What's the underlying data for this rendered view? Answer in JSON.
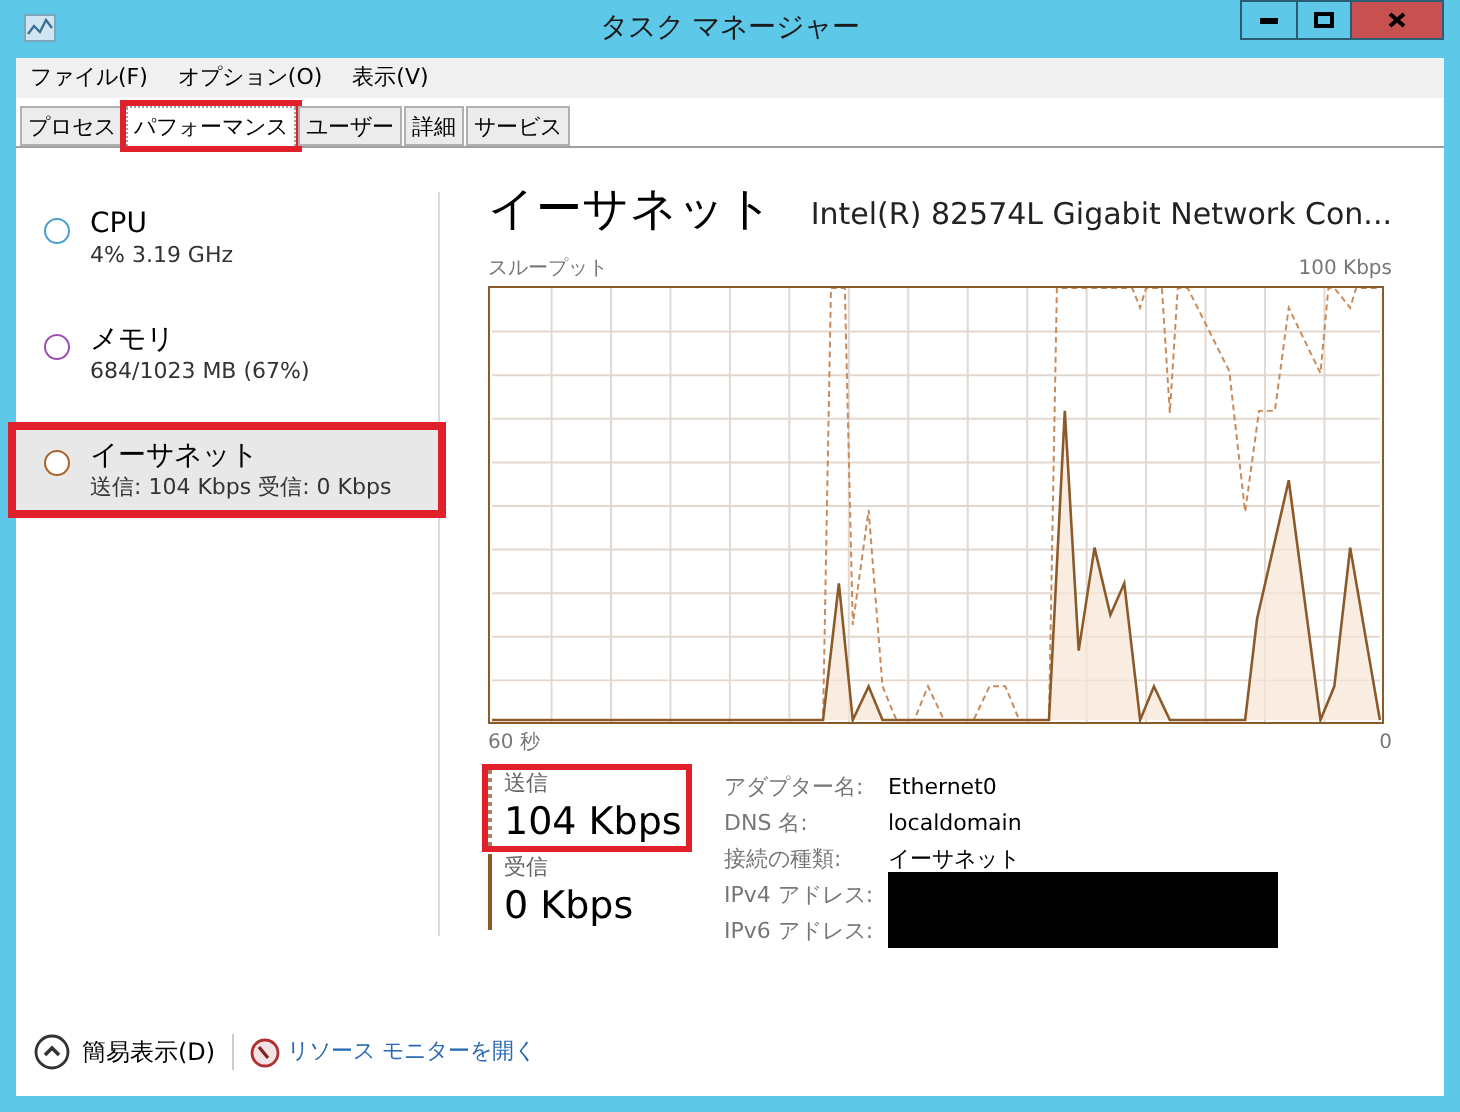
{
  "window": {
    "title": "タスク マネージャー"
  },
  "menu": [
    "ファイル(F)",
    "オプション(O)",
    "表示(V)"
  ],
  "tabs": [
    {
      "label": "プロセス",
      "selected": false,
      "highlighted": false
    },
    {
      "label": "パフォーマンス",
      "selected": true,
      "highlighted": true
    },
    {
      "label": "ユーザー",
      "selected": false,
      "highlighted": false
    },
    {
      "label": "詳細",
      "selected": false,
      "highlighted": false
    },
    {
      "label": "サービス",
      "selected": false,
      "highlighted": false
    }
  ],
  "sidebar": {
    "items": [
      {
        "name": "CPU",
        "detail": "4% 3.19 GHz",
        "color": "#4a9fd0",
        "selected": false,
        "highlighted": false
      },
      {
        "name": "メモリ",
        "detail": "684/1023 MB (67%)",
        "color": "#9b4fb0",
        "selected": false,
        "highlighted": false
      },
      {
        "name": "イーサネット",
        "detail": "送信: 104 Kbps 受信: 0 Kbps",
        "color": "#a7642a",
        "selected": true,
        "highlighted": true
      }
    ]
  },
  "main": {
    "title": "イーサネット",
    "adapter": "Intel(R) 82574L Gigabit Network Con...",
    "graph": {
      "label": "スループット",
      "max": "100 Kbps",
      "x_start": "60 秒",
      "x_end": "0"
    },
    "stats": [
      {
        "kind": "send",
        "label": "送信",
        "value": "104 Kbps",
        "highlighted": true
      },
      {
        "kind": "receive",
        "label": "受信",
        "value": "0 Kbps",
        "highlighted": false
      }
    ],
    "details": [
      {
        "label": "アダプター名:",
        "value": "Ethernet0",
        "redacted": false
      },
      {
        "label": "DNS 名:",
        "value": "localdomain",
        "redacted": false
      },
      {
        "label": "接続の種類:",
        "value": "イーサネット",
        "redacted": false
      },
      {
        "label": "IPv4 アドレス:",
        "redacted": true
      },
      {
        "label": "IPv6 アドレス:",
        "redacted": true
      }
    ]
  },
  "footer": {
    "summary": "簡易表示(D)",
    "link": "リソース モニターを開く"
  }
}
